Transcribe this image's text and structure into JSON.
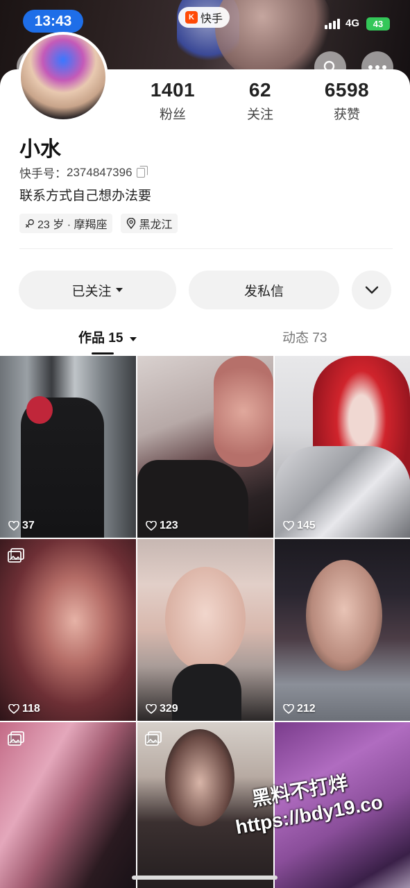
{
  "status_bar": {
    "time": "13:43",
    "network": "4G",
    "battery": "43"
  },
  "app_badge": {
    "logo_char": "K",
    "label": "快手"
  },
  "profile": {
    "name": "小水",
    "kuaishou_id_label": "快手号：",
    "kuaishou_id": "2374847396",
    "bio": "联系方式自己想办法要",
    "tags": [
      {
        "icon": "gender-icon",
        "text": "23 岁 · 摩羯座"
      },
      {
        "icon": "location-icon",
        "text": "黑龙江"
      }
    ]
  },
  "stats": [
    {
      "value": "1401",
      "label": "粉丝"
    },
    {
      "value": "62",
      "label": "关注"
    },
    {
      "value": "6598",
      "label": "获赞"
    }
  ],
  "actions": {
    "follow": "已关注",
    "message": "发私信"
  },
  "tabs": {
    "works": "作品 15",
    "moments": "动态 73"
  },
  "grid": [
    {
      "likes": "37",
      "multi": false
    },
    {
      "likes": "123",
      "multi": false
    },
    {
      "likes": "145",
      "multi": false
    },
    {
      "likes": "118",
      "multi": true
    },
    {
      "likes": "329",
      "multi": false
    },
    {
      "likes": "212",
      "multi": false
    },
    {
      "likes": "",
      "multi": true
    },
    {
      "likes": "",
      "multi": true
    },
    {
      "likes": "",
      "multi": false
    }
  ],
  "watermark": {
    "line1": "黑料不打烊",
    "line2": "https://bdy19.co"
  },
  "colors": {
    "time_pill": "#1e6ee8",
    "battery": "#34c759",
    "brand": "#ff4906"
  }
}
